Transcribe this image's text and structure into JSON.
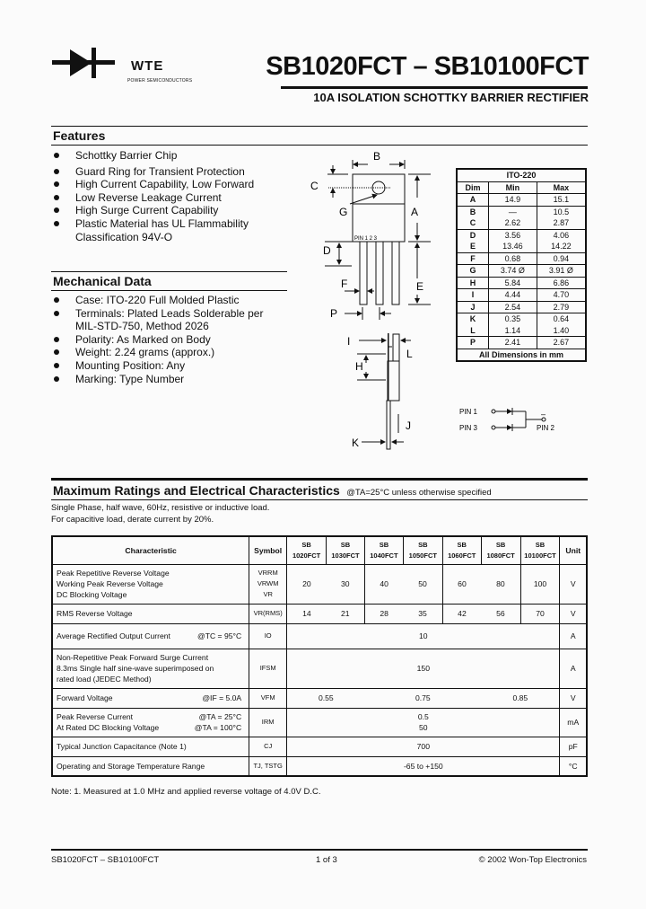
{
  "header": {
    "logo": {
      "brand": "WTE",
      "tagline": "POWER SEMICONDUCTORS",
      "icon": "diode-icon"
    },
    "title": "SB1020FCT – SB10100FCT",
    "subtitle": "10A ISOLATION SCHOTTKY BARRIER RECTIFIER"
  },
  "features": {
    "title": "Features",
    "items": [
      "Schottky Barrier Chip",
      "Guard Ring for Transient Protection",
      "High Current Capability, Low Forward",
      "Low Reverse Leakage Current",
      "High Surge Current Capability",
      "Plastic Material has UL Flammability Classification 94V-O"
    ]
  },
  "mechanical": {
    "title": "Mechanical Data",
    "items": [
      "Case: ITO-220 Full Molded Plastic",
      "Terminals: Plated Leads Solderable per MIL-STD-750, Method 2026",
      "Polarity: As Marked on Body",
      "Weight: 2.24 grams (approx.)",
      "Mounting Position: Any",
      "Marking: Type Number"
    ]
  },
  "package_diagram": {
    "labels": [
      "B",
      "C",
      "G",
      "A",
      "D",
      "E",
      "F",
      "P",
      "I",
      "L",
      "H",
      "J",
      "K"
    ],
    "pin_labels": [
      "PIN 1",
      "2",
      "3"
    ]
  },
  "dimensions": {
    "package": "ITO-220",
    "headers": [
      "Dim",
      "Min",
      "Max"
    ],
    "rows": [
      [
        "A",
        "14.9",
        "15.1"
      ],
      [
        "B",
        "—",
        "10.5"
      ],
      [
        "C",
        "2.62",
        "2.87"
      ],
      [
        "D",
        "3.56",
        "4.06"
      ],
      [
        "E",
        "13.46",
        "14.22"
      ],
      [
        "F",
        "0.68",
        "0.94"
      ],
      [
        "G",
        "3.74 Ø",
        "3.91 Ø"
      ],
      [
        "H",
        "5.84",
        "6.86"
      ],
      [
        "I",
        "4.44",
        "4.70"
      ],
      [
        "J",
        "2.54",
        "2.79"
      ],
      [
        "K",
        "0.35",
        "0.64"
      ],
      [
        "L",
        "1.14",
        "1.40"
      ],
      [
        "P",
        "2.41",
        "2.67"
      ]
    ],
    "footer": "All Dimensions in mm"
  },
  "pin_diagram": {
    "pin1": "PIN 1",
    "pin3": "PIN 3",
    "pin2": "PIN 2",
    "sign": "–"
  },
  "ratings": {
    "title": "Maximum Ratings and Electrical Characteristics",
    "condition": "@TA=25°C unless otherwise specified",
    "notes": [
      "Single Phase, half wave, 60Hz, resistive or inductive load.",
      "For capacitive load, derate current by 20%."
    ],
    "headers": {
      "characteristic": "Characteristic",
      "symbol": "Symbol",
      "parts": [
        {
          "top": "SB",
          "bottom": "1020FCT"
        },
        {
          "top": "SB",
          "bottom": "1030FCT"
        },
        {
          "top": "SB",
          "bottom": "1040FCT"
        },
        {
          "top": "SB",
          "bottom": "1050FCT"
        },
        {
          "top": "SB",
          "bottom": "1060FCT"
        },
        {
          "top": "SB",
          "bottom": "1080FCT"
        },
        {
          "top": "SB",
          "bottom": "10100FCT"
        }
      ],
      "unit": "Unit"
    },
    "rows": [
      {
        "char": [
          "Peak Repetitive Reverse Voltage",
          "Working Peak Reverse Voltage",
          "DC Blocking Voltage"
        ],
        "cond": "",
        "symbol": [
          "VRRM",
          "VRWM",
          "VR"
        ],
        "values": [
          "20",
          "30",
          "40",
          "50",
          "60",
          "80",
          "100"
        ],
        "unit": "V"
      },
      {
        "char": [
          "RMS Reverse Voltage"
        ],
        "cond": "",
        "symbol": [
          "VR(RMS)"
        ],
        "values": [
          "14",
          "21",
          "28",
          "35",
          "42",
          "56",
          "70"
        ],
        "unit": "V"
      },
      {
        "char": [
          "Average Rectified Output Current"
        ],
        "cond": "@TC = 95°C",
        "symbol": [
          "IO"
        ],
        "span_value": "10",
        "unit": "A"
      },
      {
        "char": [
          "Non-Repetitive Peak Forward Surge Current",
          "8.3ms Single half sine-wave superimposed on",
          "rated load (JEDEC Method)"
        ],
        "cond": "",
        "symbol": [
          "IFSM"
        ],
        "span_value": "150",
        "unit": "A"
      },
      {
        "char": [
          "Forward Voltage"
        ],
        "cond": "@IF = 5.0A",
        "symbol": [
          "VFM"
        ],
        "group_values": [
          "0.55",
          "0.75",
          "0.85"
        ],
        "unit": "V"
      },
      {
        "char": [
          "Peak Reverse Current",
          "At Rated DC Blocking Voltage"
        ],
        "cond": [
          "@TA = 25°C",
          "@TA = 100°C"
        ],
        "symbol": [
          "IRM"
        ],
        "span_value": [
          "0.5",
          "50"
        ],
        "unit": "mA"
      },
      {
        "char": [
          "Typical Junction Capacitance (Note 1)"
        ],
        "cond": "",
        "symbol": [
          "CJ"
        ],
        "span_value": "700",
        "unit": "pF"
      },
      {
        "char": [
          "Operating and Storage Temperature Range"
        ],
        "cond": "",
        "symbol": [
          "TJ, TSTG"
        ],
        "span_value": "-65 to +150",
        "unit": "°C"
      }
    ],
    "footnote": "Note:  1. Measured at 1.0 MHz and applied reverse voltage of 4.0V D.C."
  },
  "footer": {
    "left": "SB1020FCT – SB10100FCT",
    "center": "1 of 3",
    "right": "© 2002 Won-Top Electronics"
  }
}
